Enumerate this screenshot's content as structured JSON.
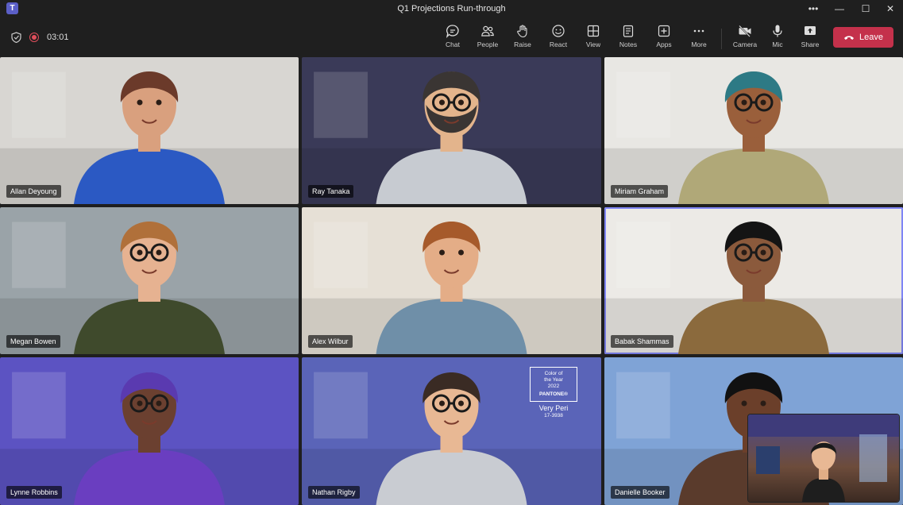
{
  "window": {
    "title": "Q1 Projections Run-through",
    "logo_text": "T"
  },
  "meeting": {
    "timer": "03:01"
  },
  "toolbar": {
    "chat": "Chat",
    "people": "People",
    "raise": "Raise",
    "react": "React",
    "view": "View",
    "notes": "Notes",
    "apps": "Apps",
    "more": "More",
    "camera": "Camera",
    "mic": "Mic",
    "share": "Share",
    "leave": "Leave"
  },
  "participants": [
    {
      "name": "Allan Deyoung",
      "bg": "#d8d6d2",
      "skin": "#d9a07e",
      "hair": "#6b3a2a",
      "shirt": "#2b59c3",
      "glasses": false,
      "beard": false
    },
    {
      "name": "Ray Tanaka",
      "bg": "#3a3a58",
      "skin": "#e3b48c",
      "hair": "#3a3533",
      "shirt": "#c7cbd1",
      "glasses": true,
      "beard": true
    },
    {
      "name": "Miriam Graham",
      "bg": "#e8e7e3",
      "skin": "#9a5f3b",
      "hair": "#2d7a85",
      "shirt": "#b0a878",
      "glasses": true,
      "beard": false
    },
    {
      "name": "Megan Bowen",
      "bg": "#9aa3a8",
      "skin": "#e6b291",
      "hair": "#b0703a",
      "shirt": "#3f4a2c",
      "glasses": true,
      "beard": false
    },
    {
      "name": "Alex Wilbur",
      "bg": "#e6e0d6",
      "skin": "#e4ad87",
      "hair": "#a65a2b",
      "shirt": "#6f8fa8",
      "glasses": false,
      "beard": false
    },
    {
      "name": "Babak Shammas",
      "bg": "#eceae6",
      "skin": "#8b5a3c",
      "hair": "#141414",
      "shirt": "#8b6a3d",
      "glasses": true,
      "beard": false
    },
    {
      "name": "Lynne Robbins",
      "bg": "#5c53c2",
      "skin": "#6b4030",
      "hair": "#5a3ab0",
      "shirt": "#6a3ec0",
      "glasses": true,
      "beard": false
    },
    {
      "name": "Nathan Rigby",
      "bg": "#5a64b8",
      "skin": "#e8b894",
      "hair": "#3a2b24",
      "shirt": "#c9ccd2",
      "glasses": true,
      "beard": false
    },
    {
      "name": "Danielle Booker",
      "bg": "#7fa3d6",
      "skin": "#6b3f2a",
      "hair": "#111111",
      "shirt": "#5a3b2c",
      "glasses": false,
      "beard": false
    }
  ],
  "active_speaker": "Babak Shammas",
  "pantone": {
    "line1": "Color of",
    "line2": "the Year",
    "line3": "2022",
    "brand": "PANTONE®",
    "color_name": "Very Peri",
    "code": "17-3938"
  },
  "colors": {
    "leave": "#c4314b",
    "accent": "#7f85f5",
    "record": "#e04e5b"
  }
}
